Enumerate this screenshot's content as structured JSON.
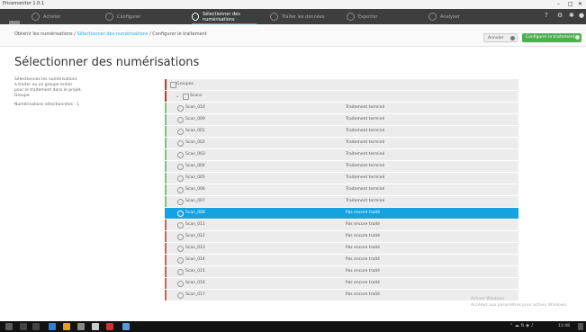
{
  "window": {
    "title": "Pricemonitor 1.0.1"
  },
  "steps": [
    {
      "label": "Acheter"
    },
    {
      "label": "Configurer"
    },
    {
      "label": "Sélectionner des numérisations"
    },
    {
      "label": "Traiter les données"
    },
    {
      "label": "Exporter"
    },
    {
      "label": "Analyser"
    }
  ],
  "crumbs": {
    "before": "Obtenir les numérisations  /  ",
    "current": "Sélectionner des numérisations",
    "after": "  /  Configurer le traitement"
  },
  "buttons": {
    "secondary": "Annuler",
    "primary": "Configurer le traitement"
  },
  "page_title": "Sélectionner des numérisations",
  "sidebar": {
    "lines": [
      "Sélectionnez les numérisations",
      "à traiter ou un groupe entier",
      "pour le traitement dans le projet.",
      "Groupe"
    ],
    "extra": "Numérisations sélectionnées : 1"
  },
  "tree": {
    "group": "Groupes",
    "subgroup": "Scans",
    "items": [
      {
        "name": "Scan_010",
        "status": "Traitement terminé",
        "tone": "green"
      },
      {
        "name": "Scan_009",
        "status": "Traitement terminé",
        "tone": "green"
      },
      {
        "name": "Scan_001",
        "status": "Traitement terminé",
        "tone": "green"
      },
      {
        "name": "Scan_002",
        "status": "Traitement terminé",
        "tone": "green"
      },
      {
        "name": "Scan_003",
        "status": "Traitement terminé",
        "tone": "green"
      },
      {
        "name": "Scan_004",
        "status": "Traitement terminé",
        "tone": "green"
      },
      {
        "name": "Scan_005",
        "status": "Traitement terminé",
        "tone": "green"
      },
      {
        "name": "Scan_006",
        "status": "Traitement terminé",
        "tone": "green"
      },
      {
        "name": "Scan_007",
        "status": "Traitement terminé",
        "tone": "green"
      },
      {
        "name": "Scan_008",
        "status": "Pas encore traité",
        "tone": "sel"
      },
      {
        "name": "Scan_011",
        "status": "Pas encore traité",
        "tone": "red"
      },
      {
        "name": "Scan_012",
        "status": "Pas encore traité",
        "tone": "red"
      },
      {
        "name": "Scan_013",
        "status": "Pas encore traité",
        "tone": "red"
      },
      {
        "name": "Scan_014",
        "status": "Pas encore traité",
        "tone": "red"
      },
      {
        "name": "Scan_015",
        "status": "Pas encore traité",
        "tone": "red"
      },
      {
        "name": "Scan_016",
        "status": "Pas encore traité",
        "tone": "red"
      },
      {
        "name": "Scan_017",
        "status": "Pas encore traité",
        "tone": "red"
      }
    ]
  },
  "watermark": {
    "line1": "Activer Windows",
    "line2": "Accédez aux paramètres pour activer Windows."
  },
  "taskbar": {
    "clock": "11:48"
  },
  "colors": {
    "accent": "#14a3e0",
    "primary_button": "#4caf50",
    "error_tone": "#cc3333",
    "ok_tone": "#7cc47c"
  }
}
